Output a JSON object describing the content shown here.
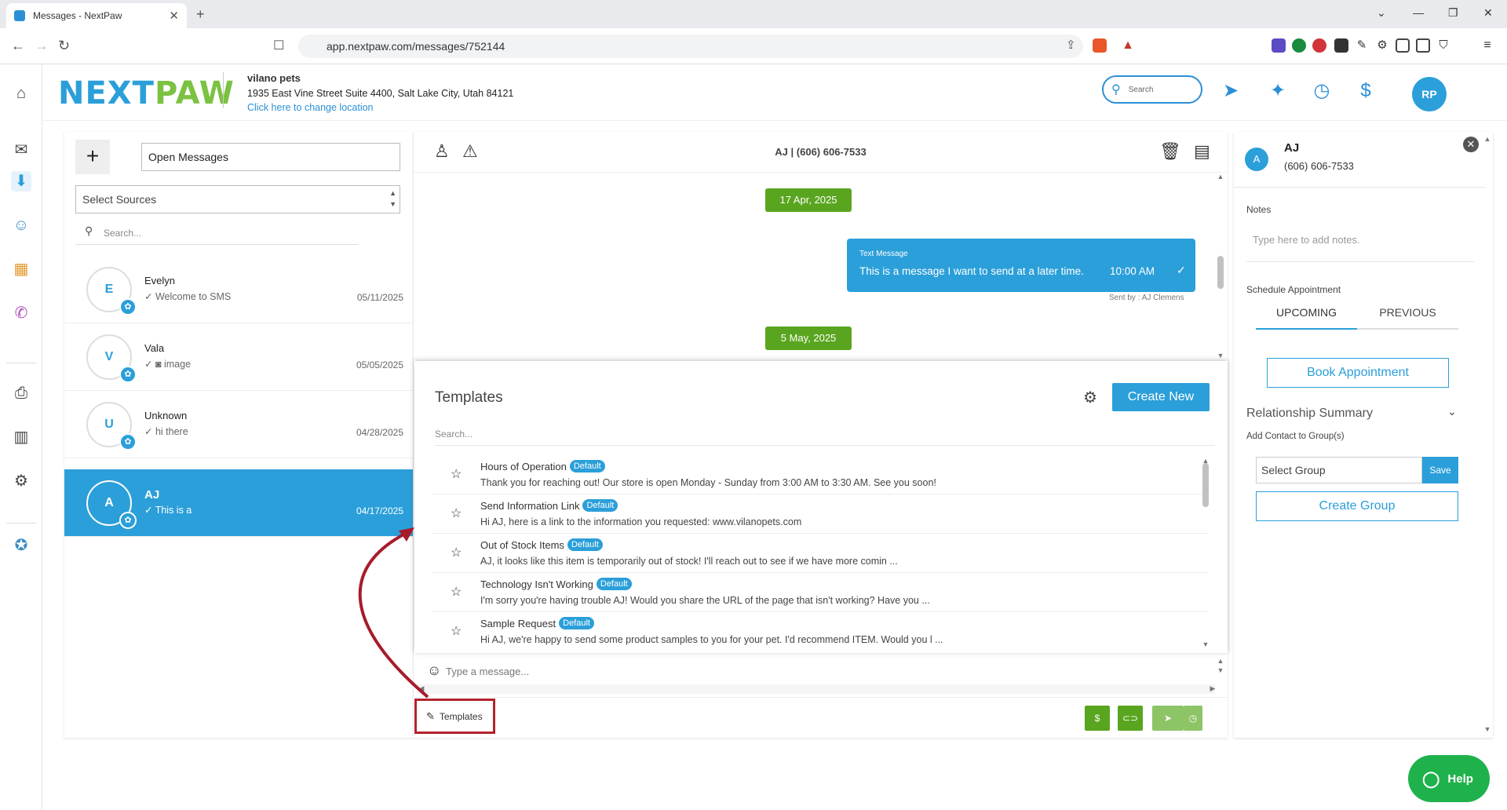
{
  "browser": {
    "tab_title": "Messages - NextPaw",
    "url": "app.nextpaw.com/messages/752144"
  },
  "header": {
    "logo_next": "NEXT",
    "logo_paw": "PAW",
    "location_name": "vilano pets",
    "address": "1935 East Vine Street Suite 4400, Salt Lake City, Utah 84121",
    "change_location": "Click here to change location",
    "search_placeholder": "Search",
    "avatar_initials": "RP"
  },
  "conversations": {
    "filter": "Open Messages",
    "sources_placeholder": "Select Sources",
    "search_placeholder": "Search...",
    "items": [
      {
        "initial": "E",
        "name": "Evelyn",
        "preview": "✓ Welcome to SMS",
        "date": "05/11/2025"
      },
      {
        "initial": "V",
        "name": "Vala",
        "preview": "✓ ◙ image",
        "date": "05/05/2025"
      },
      {
        "initial": "U",
        "name": "Unknown",
        "preview": "✓ hi there",
        "date": "04/28/2025"
      },
      {
        "initial": "A",
        "name": "AJ",
        "preview": "✓ This is a",
        "date": "04/17/2025"
      }
    ]
  },
  "chat": {
    "title": "AJ | (606) 606-7533",
    "date1": "17 Apr, 2025",
    "message_type": "Text Message",
    "message_text": "This is a message I want to send at a later time.",
    "message_time": "10:00 AM",
    "sent_by": "Sent by : AJ Clemens",
    "date2": "5 May, 2025",
    "compose_placeholder": "Type a message..."
  },
  "templates": {
    "heading": "Templates",
    "create_new": "Create New",
    "search_placeholder": "Search...",
    "default_badge": "Default",
    "items": [
      {
        "title": "Hours of Operation",
        "body": "Thank you for reaching out! Our store is open Monday - Sunday from 3:00 AM to 3:30 AM. See you soon!"
      },
      {
        "title": "Send Information Link",
        "body": "Hi AJ, here is a link to the information you requested: www.vilanopets.com"
      },
      {
        "title": "Out of Stock Items",
        "body": "AJ, it looks like this item is temporarily out of stock! I'll reach out to see if we have more comin ..."
      },
      {
        "title": "Technology Isn't Working",
        "body": "I'm sorry you're having trouble AJ! Would you share the URL of the page that isn't working? Have you ..."
      },
      {
        "title": "Sample Request",
        "body": "Hi AJ, we're happy to send some product samples to you for your pet. I'd recommend ITEM. Would you l ..."
      }
    ],
    "button_label": "Templates"
  },
  "footer_buttons": {
    "dollar": "$",
    "link": "⊂⊃",
    "send": "➤",
    "schedule": "◷"
  },
  "details": {
    "initial": "A",
    "name": "AJ",
    "phone": "(606) 606-7533",
    "notes_label": "Notes",
    "notes_placeholder": "Type here to add notes.",
    "schedule_label": "Schedule Appointment",
    "tab_upcoming": "UPCOMING",
    "tab_previous": "PREVIOUS",
    "book_appointment": "Book Appointment",
    "relationship_summary": "Relationship Summary",
    "add_contact_label": "Add Contact to Group(s)",
    "select_group": "Select Group",
    "save": "Save",
    "create_group": "Create Group"
  },
  "help": "Help",
  "colors": {
    "brand_blue": "#2b9fd9",
    "brand_green": "#7cc242",
    "action_green": "#5aa51f",
    "highlight_red": "#b4232c"
  }
}
